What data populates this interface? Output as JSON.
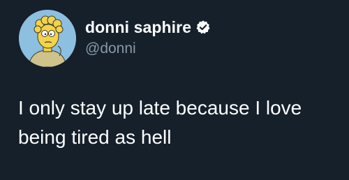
{
  "user": {
    "display_name": "donni saphire",
    "handle": "@donni",
    "verified": true,
    "avatar_icon": "cartoon-character-avatar-icon",
    "verified_icon": "verified-badge-icon"
  },
  "tweet": {
    "text": "I only stay up late because I love being tired as hell"
  },
  "colors": {
    "background": "#15202b",
    "text_primary": "#ffffff",
    "text_secondary": "#8899a6",
    "verified_badge": "#ffffff"
  }
}
